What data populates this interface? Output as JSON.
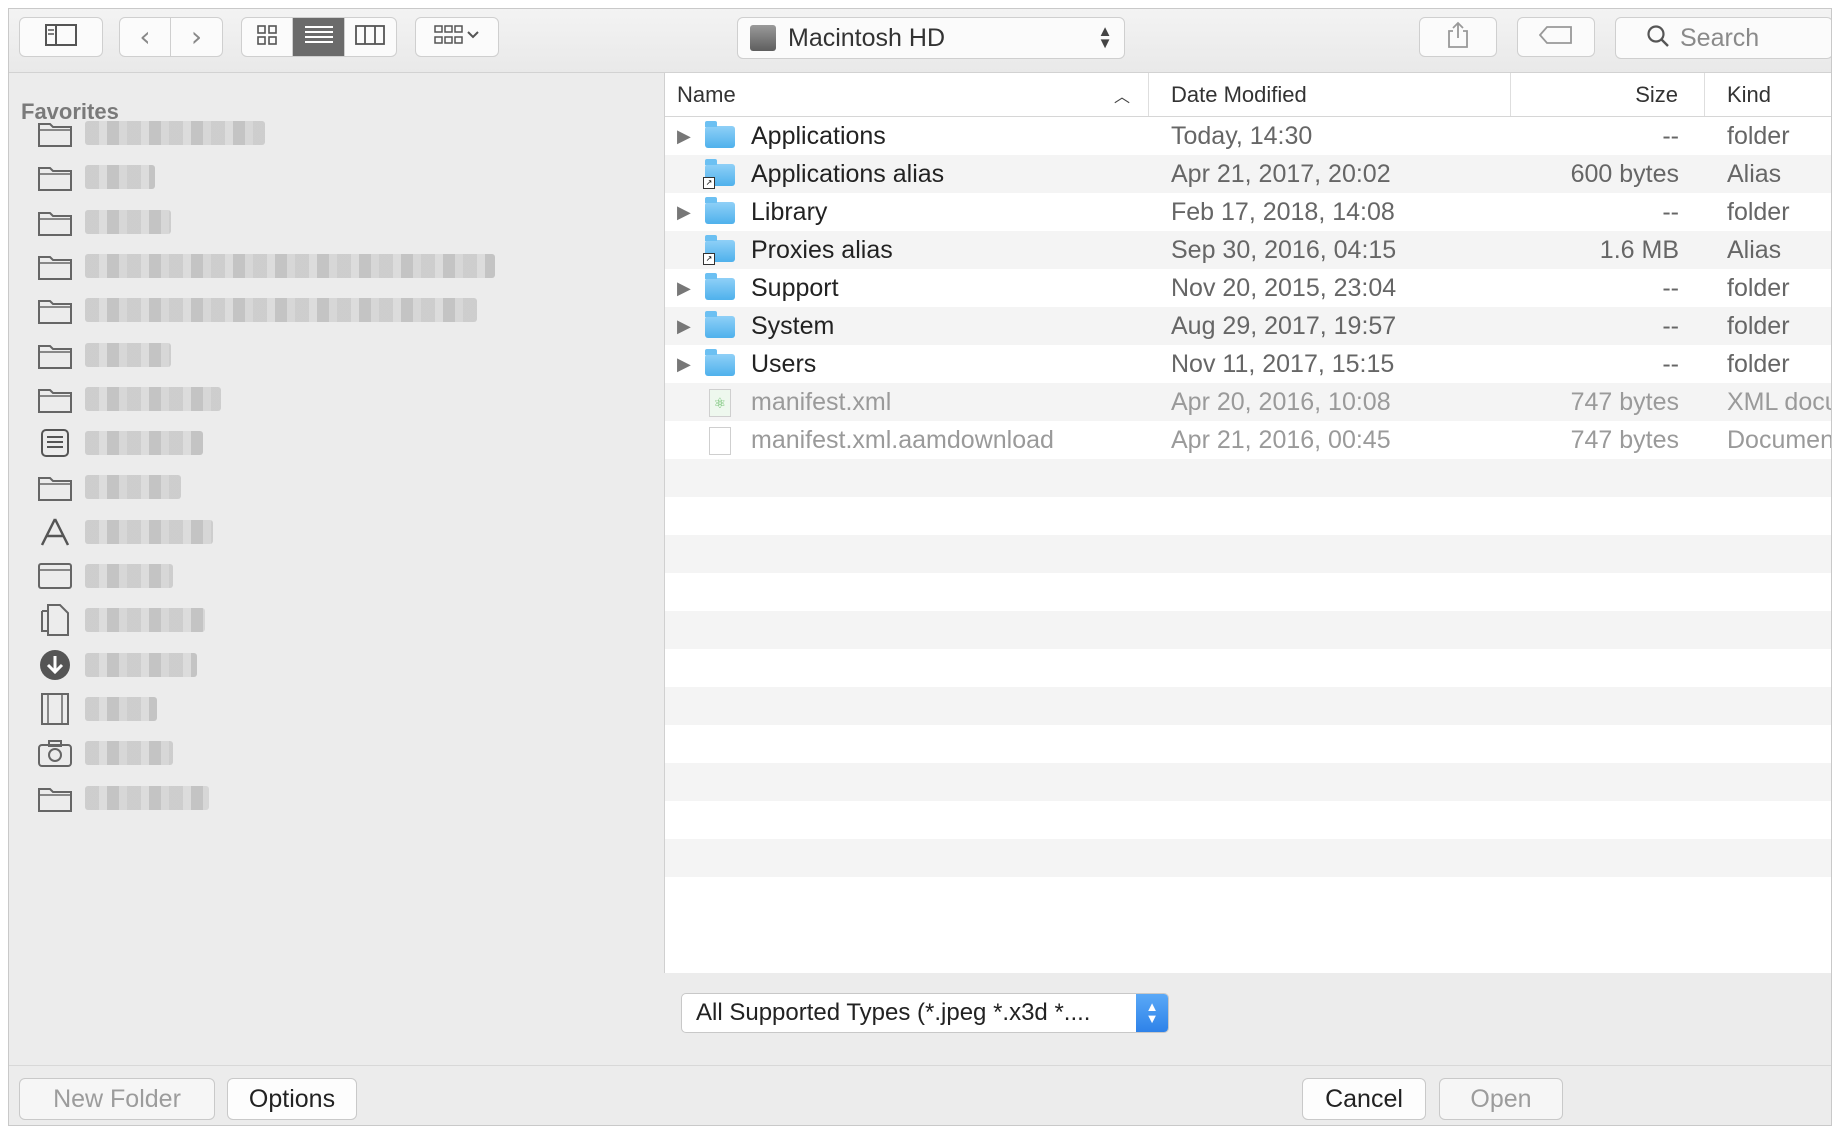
{
  "toolbar": {
    "location_label": "Macintosh HD",
    "search_placeholder": "Search"
  },
  "sidebar": {
    "section_title": "Favorites",
    "items": [
      {
        "icon": "folder-icon",
        "blur_width": 180
      },
      {
        "icon": "folder-icon",
        "blur_width": 70
      },
      {
        "icon": "folder-icon",
        "blur_width": 86
      },
      {
        "icon": "folder-icon",
        "blur_width": 410
      },
      {
        "icon": "folder-icon",
        "blur_width": 392
      },
      {
        "icon": "folder-icon",
        "blur_width": 86
      },
      {
        "icon": "folder-icon",
        "blur_width": 136
      },
      {
        "icon": "inbox-icon",
        "blur_width": 118
      },
      {
        "icon": "folder-icon",
        "blur_width": 96
      },
      {
        "icon": "applications-icon",
        "blur_width": 128
      },
      {
        "icon": "desktop-icon",
        "blur_width": 88
      },
      {
        "icon": "documents-icon",
        "blur_width": 120
      },
      {
        "icon": "downloads-icon",
        "blur_width": 112
      },
      {
        "icon": "movies-icon",
        "blur_width": 72
      },
      {
        "icon": "camera-icon",
        "blur_width": 88
      },
      {
        "icon": "folder-icon",
        "blur_width": 124
      }
    ]
  },
  "list": {
    "columns": {
      "name": "Name",
      "date": "Date Modified",
      "size": "Size",
      "kind": "Kind"
    },
    "rows": [
      {
        "name": "Applications",
        "date": "Today, 14:30",
        "size": "--",
        "kind": "folder",
        "disclosure": "▶",
        "icon": "applications-folder-icon",
        "dim": false,
        "alias": false,
        "type": "folder"
      },
      {
        "name": "Applications alias",
        "date": "Apr 21, 2017, 20:02",
        "size": "600 bytes",
        "kind": "Alias",
        "disclosure": "",
        "icon": "applications-alias-icon",
        "dim": false,
        "alias": true,
        "type": "folder"
      },
      {
        "name": "Library",
        "date": "Feb 17, 2018, 14:08",
        "size": "--",
        "kind": "folder",
        "disclosure": "▶",
        "icon": "library-folder-icon",
        "dim": false,
        "alias": false,
        "type": "folder"
      },
      {
        "name": "Proxies alias",
        "date": "Sep 30, 2016, 04:15",
        "size": "1.6 MB",
        "kind": "Alias",
        "disclosure": "",
        "icon": "proxies-alias-icon",
        "dim": false,
        "alias": true,
        "type": "folder"
      },
      {
        "name": "Support",
        "date": "Nov 20, 2015, 23:04",
        "size": "--",
        "kind": "folder",
        "disclosure": "▶",
        "icon": "support-folder-icon",
        "dim": false,
        "alias": false,
        "type": "folder"
      },
      {
        "name": "System",
        "date": "Aug 29, 2017, 19:57",
        "size": "--",
        "kind": "folder",
        "disclosure": "▶",
        "icon": "system-folder-icon",
        "dim": false,
        "alias": false,
        "type": "folder"
      },
      {
        "name": "Users",
        "date": "Nov 11, 2017, 15:15",
        "size": "--",
        "kind": "folder",
        "disclosure": "▶",
        "icon": "users-folder-icon",
        "dim": false,
        "alias": false,
        "type": "folder"
      },
      {
        "name": "manifest.xml",
        "date": "Apr 20, 2016, 10:08",
        "size": "747 bytes",
        "kind": "XML document",
        "disclosure": "",
        "icon": "xml-file-icon",
        "dim": true,
        "alias": false,
        "type": "xml"
      },
      {
        "name": "manifest.xml.aamdownload",
        "date": "Apr 21, 2016, 00:45",
        "size": "747 bytes",
        "kind": "Document",
        "disclosure": "",
        "icon": "document-file-icon",
        "dim": true,
        "alias": false,
        "type": "doc"
      }
    ]
  },
  "filter": {
    "selected": "All Supported Types (*.jpeg *.x3d *...."
  },
  "buttons": {
    "new_folder": "New Folder",
    "options": "Options",
    "cancel": "Cancel",
    "open": "Open"
  }
}
